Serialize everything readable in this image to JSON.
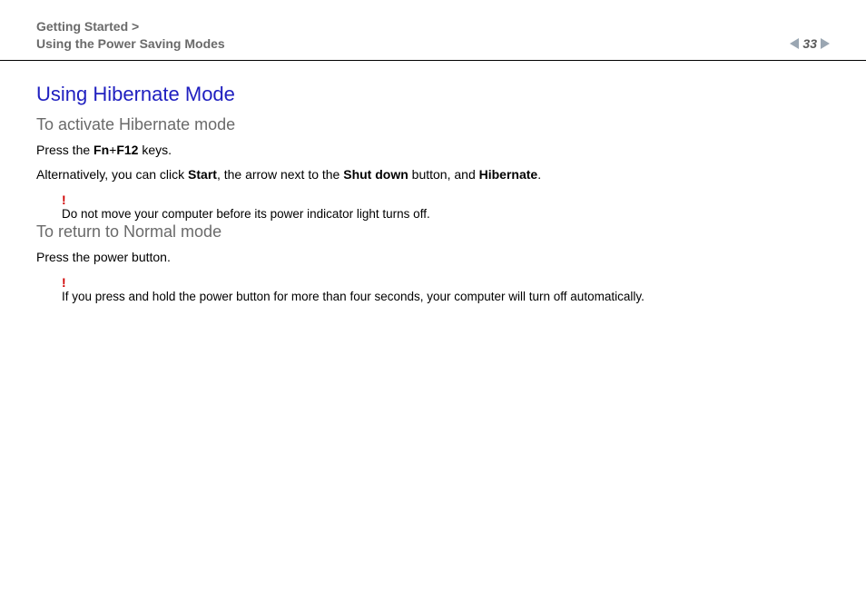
{
  "header": {
    "breadcrumb_line1": "Getting Started >",
    "breadcrumb_line2": "Using the Power Saving Modes",
    "page_number": "33"
  },
  "content": {
    "title": "Using Hibernate Mode",
    "sec1": {
      "heading": "To activate Hibernate mode",
      "line1_pre": "Press the ",
      "line1_b1": "Fn",
      "line1_plus": "+",
      "line1_b2": "F12",
      "line1_post": " keys.",
      "line2_pre": "Alternatively, you can click ",
      "line2_b1": "Start",
      "line2_mid1": ", the arrow next to the ",
      "line2_b2": "Shut down",
      "line2_mid2": " button, and ",
      "line2_b3": "Hibernate",
      "line2_post": ".",
      "warn_mark": "!",
      "warn_text": "Do not move your computer before its power indicator light turns off."
    },
    "sec2": {
      "heading": "To return to Normal mode",
      "line1": "Press the power button.",
      "warn_mark": "!",
      "warn_text": "If you press and hold the power button for more than four seconds, your computer will turn off automatically."
    }
  }
}
